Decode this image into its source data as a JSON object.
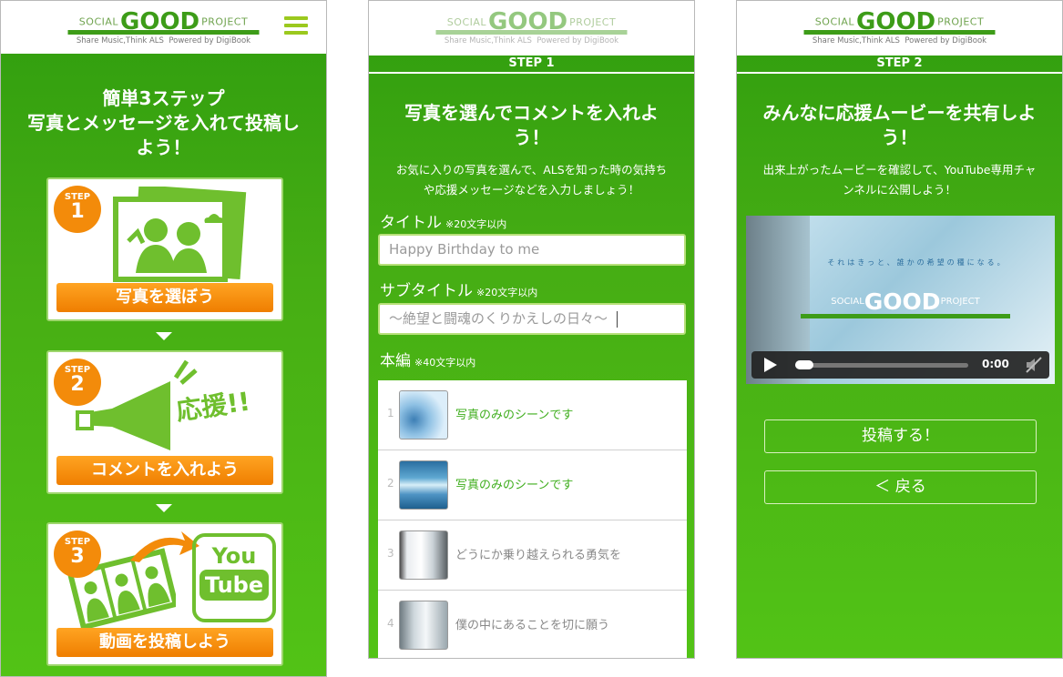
{
  "brand": {
    "social": "SOCIAL",
    "good": "GOOD",
    "project": "PROJECT",
    "tagline": "Share Music,Think ALS",
    "powered": "Powered by DigiBook"
  },
  "colors": {
    "green": "#46ad14",
    "orange": "#ef7e00",
    "white": "#ffffff"
  },
  "panel1": {
    "title_lines": [
      "簡単3ステップ",
      "写真とメッセージを入れて投稿し",
      "よう！"
    ],
    "steps": [
      {
        "badge_top": "STEP",
        "badge_num": "1",
        "button": "写真を選ぼう",
        "icon": "photo-people-icon"
      },
      {
        "badge_top": "STEP",
        "badge_num": "2",
        "button": "コメントを入れよう",
        "icon": "megaphone-icon",
        "shout": "応援!!"
      },
      {
        "badge_top": "STEP",
        "badge_num": "3",
        "button": "動画を投稿しよう",
        "icon": "youtube-upload-icon",
        "yt1": "You",
        "yt2": "Tube"
      }
    ]
  },
  "panel2": {
    "step_label": "STEP 1",
    "title_lines": [
      "写真を選んでコメントを入れよ",
      "う！"
    ],
    "desc_lines": [
      "お気に入りの写真を選んで、ALSを知った時の気持ち",
      "や応援メッセージなどを入力しましょう！"
    ],
    "title_label": "タイトル",
    "title_note": "※20文字以内",
    "title_value": "Happy Birthday to me",
    "subtitle_label": "サブタイトル",
    "subtitle_note": "※20文字以内",
    "subtitle_value": "〜絶望と闘魂のくりかえしの日々〜",
    "body_label": "本編",
    "body_note": "※40文字以内",
    "scenes": [
      {
        "num": "1",
        "text": "写真のみのシーンです",
        "style": "green"
      },
      {
        "num": "2",
        "text": "写真のみのシーンです",
        "style": "green"
      },
      {
        "num": "3",
        "text": "どうにか乗り越えられる勇気を",
        "style": "gray"
      },
      {
        "num": "4",
        "text": "僕の中にあることを切に願う",
        "style": "gray"
      }
    ]
  },
  "panel3": {
    "step_label": "STEP 2",
    "title_lines": [
      "みんなに応援ムービーを共有しよ",
      "う！"
    ],
    "desc_lines": [
      "出来上がったムービーを確認して、YouTube専用チャ",
      "ンネルに公開しよう！"
    ],
    "video_caption": "それはきっと、誰かの希望の種になる。",
    "time": "0:00",
    "post_button": "投稿する！",
    "back_button": "＜ 戻る"
  }
}
